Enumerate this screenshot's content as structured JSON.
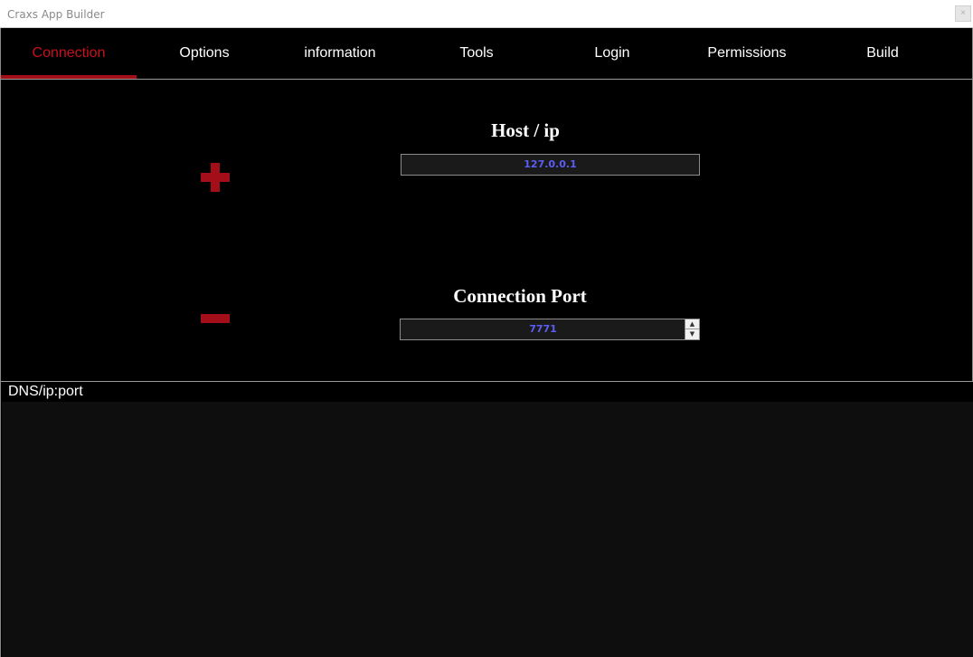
{
  "window": {
    "title": "Craxs App Builder",
    "close_label": "×"
  },
  "tabs": [
    {
      "label": "Connection",
      "active": true
    },
    {
      "label": "Options",
      "active": false
    },
    {
      "label": "information",
      "active": false
    },
    {
      "label": "Tools",
      "active": false
    },
    {
      "label": "Login",
      "active": false
    },
    {
      "label": "Permissions",
      "active": false
    },
    {
      "label": "Build",
      "active": false
    }
  ],
  "connection": {
    "host_label": "Host / ip",
    "host_value": "127.0.0.1",
    "port_label": "Connection Port",
    "port_value": "7771",
    "add_icon": "plus-icon",
    "remove_icon": "minus-icon"
  },
  "list": {
    "column_header": "DNS/ip:port",
    "rows": []
  },
  "colors": {
    "accent": "#a30e18",
    "active_tab_text": "#c8101e",
    "field_text": "#5a5ef5",
    "background": "#000000"
  }
}
